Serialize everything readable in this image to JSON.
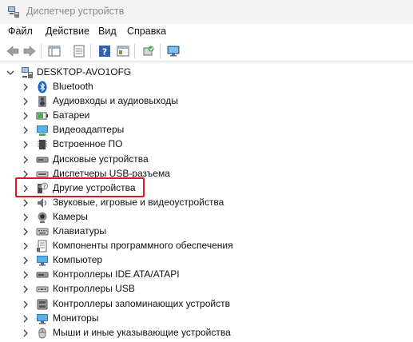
{
  "window": {
    "title": "Диспетчер устройств"
  },
  "menu": {
    "items": [
      "Файл",
      "Действие",
      "Вид",
      "Справка"
    ]
  },
  "tree": {
    "root": "DESKTOP-AVO1OFG",
    "categories": [
      {
        "label": "Bluetooth",
        "icon": "bluetooth-icon"
      },
      {
        "label": "Аудиовходы и аудиовыходы",
        "icon": "speaker-icon"
      },
      {
        "label": "Батареи",
        "icon": "battery-icon"
      },
      {
        "label": "Видеоадаптеры",
        "icon": "display-adapter-icon"
      },
      {
        "label": "Встроенное ПО",
        "icon": "firmware-icon"
      },
      {
        "label": "Дисковые устройства",
        "icon": "disk-drive-icon"
      },
      {
        "label": "Диспетчеры USB-разъема",
        "icon": "usb-connector-icon"
      },
      {
        "label": "Другие устройства",
        "icon": "unknown-device-icon"
      },
      {
        "label": "Звуковые, игровые и видеоустройства",
        "icon": "sound-icon"
      },
      {
        "label": "Камеры",
        "icon": "camera-icon"
      },
      {
        "label": "Клавиатуры",
        "icon": "keyboard-icon"
      },
      {
        "label": "Компоненты программного обеспечения",
        "icon": "software-component-icon"
      },
      {
        "label": "Компьютер",
        "icon": "computer-icon"
      },
      {
        "label": "Контроллеры IDE ATA/ATAPI",
        "icon": "ide-controller-icon"
      },
      {
        "label": "Контроллеры USB",
        "icon": "usb-controller-icon"
      },
      {
        "label": "Контроллеры запоминающих устройств",
        "icon": "storage-controller-icon"
      },
      {
        "label": "Мониторы",
        "icon": "monitor-icon"
      },
      {
        "label": "Мыши и иные указывающие устройства",
        "icon": "mouse-icon"
      }
    ]
  },
  "colors": {
    "highlight": "#d61c1c",
    "titlebar": "#f3f3f3"
  }
}
